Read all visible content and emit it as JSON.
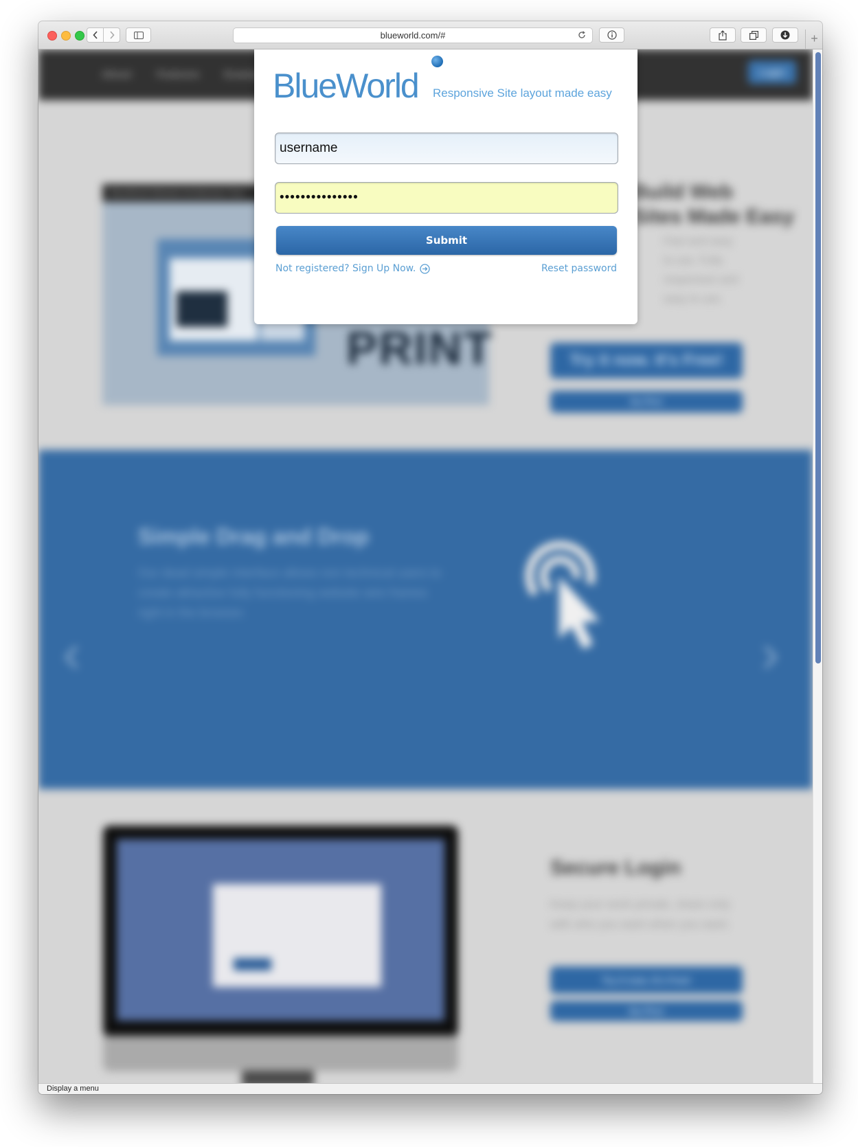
{
  "browser": {
    "url": "blueworld.com/#",
    "status_text": "Display a menu",
    "new_tab_symbol": "+"
  },
  "background_page": {
    "nav": [
      "About",
      "Features",
      "Examples"
    ],
    "login_button": "Login",
    "hero": {
      "heading_line1": "Build Web",
      "heading_line2": "Sites Made Easy",
      "text": "Fast and easy to use. Fully responsive and easy to use.",
      "screenshot_bar": "BlueWorld Website Architecture Tool",
      "screenshot_print": "PRINT",
      "cta_primary": "Try it now. It's Free!",
      "cta_secondary": "Go Pro!"
    },
    "feature": {
      "title": "Simple Drag and Drop",
      "text": "Our dead simple interface allows non technical users to create attractive fully functioning website wire frames right in the browser."
    },
    "secure": {
      "title": "Secure Login",
      "text": "Keep your work private, share only with who you want when you want.",
      "cta_primary": "Try it now. It's Free!",
      "cta_secondary": "Go Pro!"
    }
  },
  "login": {
    "logo_text": "BlueWorld",
    "tagline": "Responsive Site layout made easy",
    "username_value": "username",
    "password_value": "•••••••••••••••",
    "submit_label": "Submit",
    "signup_link": "Not registered? Sign Up Now.",
    "reset_link": "Reset password"
  },
  "colors": {
    "brand_blue": "#4a90cc",
    "button_blue": "#2b66a6",
    "link_blue": "#5b9fd3",
    "password_autofill": "#f8fcc0",
    "band_blue": "#356ba4"
  }
}
